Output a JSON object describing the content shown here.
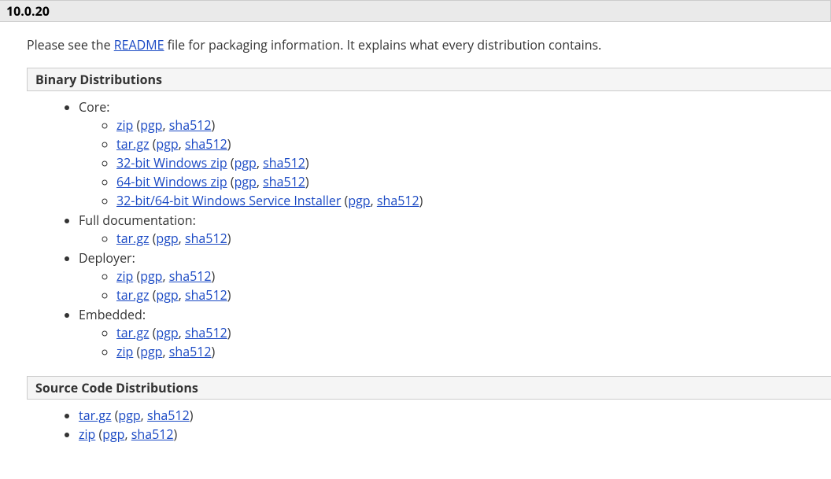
{
  "version": "10.0.20",
  "intro_prefix": "Please see the ",
  "intro_readme": "README",
  "intro_suffix": " file for packaging information. It explains what every distribution contains.",
  "sections": {
    "binary": {
      "title": "Binary Distributions",
      "groups": [
        {
          "label": "Core:",
          "items": [
            {
              "name": "zip",
              "sigs": [
                "pgp",
                "sha512"
              ]
            },
            {
              "name": "tar.gz",
              "sigs": [
                "pgp",
                "sha512"
              ]
            },
            {
              "name": "32-bit Windows zip",
              "sigs": [
                "pgp",
                "sha512"
              ]
            },
            {
              "name": "64-bit Windows zip",
              "sigs": [
                "pgp",
                "sha512"
              ]
            },
            {
              "name": "32-bit/64-bit Windows Service Installer",
              "sigs": [
                "pgp",
                "sha512"
              ]
            }
          ]
        },
        {
          "label": "Full documentation:",
          "items": [
            {
              "name": "tar.gz",
              "sigs": [
                "pgp",
                "sha512"
              ]
            }
          ]
        },
        {
          "label": "Deployer:",
          "items": [
            {
              "name": "zip",
              "sigs": [
                "pgp",
                "sha512"
              ]
            },
            {
              "name": "tar.gz",
              "sigs": [
                "pgp",
                "sha512"
              ]
            }
          ]
        },
        {
          "label": "Embedded:",
          "items": [
            {
              "name": "tar.gz",
              "sigs": [
                "pgp",
                "sha512"
              ]
            },
            {
              "name": "zip",
              "sigs": [
                "pgp",
                "sha512"
              ]
            }
          ]
        }
      ]
    },
    "source": {
      "title": "Source Code Distributions",
      "items": [
        {
          "name": "tar.gz",
          "sigs": [
            "pgp",
            "sha512"
          ]
        },
        {
          "name": "zip",
          "sigs": [
            "pgp",
            "sha512"
          ]
        }
      ]
    }
  }
}
